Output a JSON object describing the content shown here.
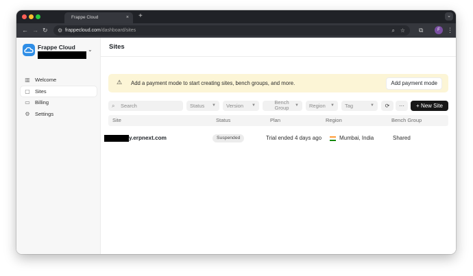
{
  "browser": {
    "tab_title": "Frappe Cloud",
    "tab_close": "×",
    "new_tab": "+",
    "tab_menu": "⌄",
    "url_domain": "frappecloud.com",
    "url_path": "/dashboard/sites",
    "profile_initial": "F"
  },
  "sidebar": {
    "org_name": "Frappe Cloud",
    "items": [
      {
        "label": "Welcome",
        "icon": "building-icon"
      },
      {
        "label": "Sites",
        "icon": "page-icon",
        "active": true
      },
      {
        "label": "Billing",
        "icon": "card-icon"
      },
      {
        "label": "Settings",
        "icon": "gear-icon"
      }
    ]
  },
  "page": {
    "title": "Sites",
    "banner": {
      "text": "Add a payment mode to start creating sites, bench groups, and more.",
      "button": "Add payment mode"
    },
    "filters": {
      "search_placeholder": "Search",
      "status": "Status",
      "version": "Version",
      "bench_group_1": "Bench",
      "bench_group_2": "Group",
      "region": "Region",
      "tag": "Tag",
      "new_site": "New Site"
    },
    "table": {
      "columns": [
        "Site",
        "Status",
        "Plan",
        "Region",
        "Bench Group"
      ],
      "rows": [
        {
          "site": "y.erpnext.com",
          "status": "Suspended",
          "plan": "Trial ended 4 days ago",
          "region": "Mumbai, India",
          "bench_group": "Shared"
        }
      ]
    }
  },
  "colors": {
    "brand_blue": "#2f8ee6",
    "banner_bg": "#fcf5d6",
    "primary_button": "#171717"
  }
}
